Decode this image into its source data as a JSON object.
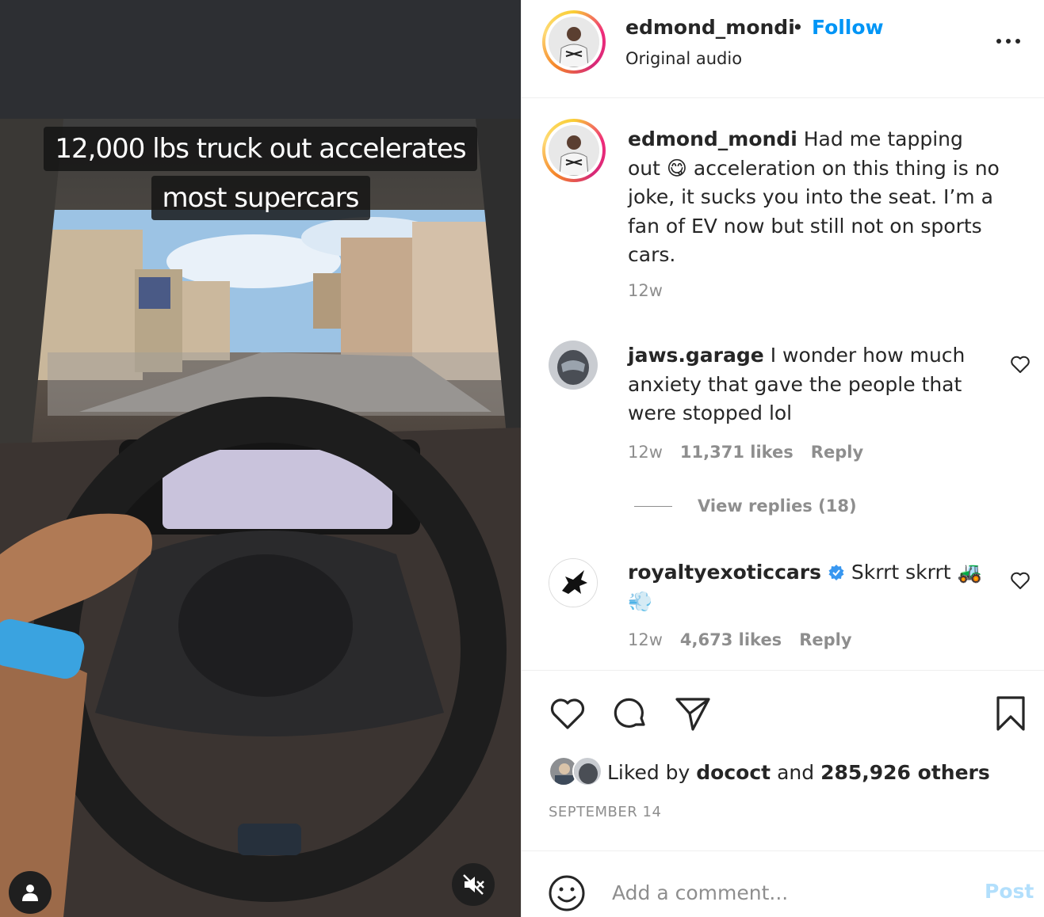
{
  "video": {
    "caption_line1": "12,000 lbs truck out accelerates",
    "caption_line2": "most supercars",
    "user_icon": "user-icon",
    "mute_icon": "muted-speaker-icon"
  },
  "header": {
    "username": "edmond_mondi",
    "separator": "•",
    "follow_label": "Follow",
    "audio_label": "Original audio",
    "more_icon": "more-options-icon"
  },
  "caption": {
    "username": "edmond_mondi",
    "text_part1": "Had me tapping out",
    "emoji": "😋",
    "text_part2": "acceleration on this thing is no joke, it sucks you into the seat. I’m a fan of EV now but still not on sports cars.",
    "time": "12w"
  },
  "comments": [
    {
      "username": "jaws.garage",
      "text": "I wonder how much anxiety that gave the people that were stopped lol",
      "time": "12w",
      "likes": "11,371 likes",
      "reply_label": "Reply",
      "view_replies": "View replies (18)"
    },
    {
      "username": "royaltyexoticcars",
      "verified_icon": "verified-badge-icon",
      "text": "Skrrt skrrt",
      "emojis": "🚜 💨",
      "time": "12w",
      "likes": "4,673 likes",
      "reply_label": "Reply"
    }
  ],
  "actions": {
    "like_icon": "heart-icon",
    "comment_icon": "comment-icon",
    "share_icon": "share-icon",
    "save_icon": "bookmark-icon",
    "liked_prefix": "Liked by",
    "liked_user": "dococt",
    "liked_and": "and",
    "liked_others": "285,926 others",
    "date": "SEPTEMBER 14"
  },
  "add_comment": {
    "placeholder": "Add a comment...",
    "post_label": "Post",
    "emoji_icon": "emoji-icon"
  },
  "colors": {
    "follow_blue": "#0095f6",
    "post_disabled": "#b2dffc",
    "secondary_text": "#8e8e8e",
    "verified_blue": "#3897f0"
  }
}
